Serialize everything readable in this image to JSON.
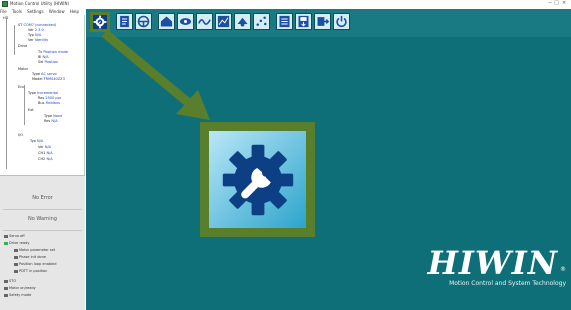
{
  "window": {
    "title": "Motion Control Utility (HIWIN)",
    "controls": [
      "−",
      "□",
      "×"
    ]
  },
  "menu": [
    "File",
    "Tools",
    "Settings",
    "Window",
    "Help"
  ],
  "tree": {
    "nodes": [
      {
        "label": "HD",
        "kind": "root"
      },
      {
        "label": "ST",
        "value": "COM7 (connected)"
      },
      {
        "label": "Ver",
        "value": "2.3.0"
      },
      {
        "label": "Typ",
        "value": "N/A"
      },
      {
        "label": "Ver",
        "value": "Identity"
      },
      {
        "label": "Drive",
        "kind": "group"
      },
      {
        "label": "Tx",
        "value": "Position mode"
      },
      {
        "label": "Bl",
        "value": "N/A"
      },
      {
        "label": "Sel",
        "value": "Position"
      },
      {
        "label": "Motor",
        "kind": "group"
      },
      {
        "label": "Type",
        "value": "AC servo"
      },
      {
        "label": "Model",
        "value": "FRMS40ZZ3"
      },
      {
        "label": "Enc",
        "kind": "group"
      },
      {
        "label": "Type",
        "value": "Incremental"
      },
      {
        "label": "Res",
        "value": "2500 ppr"
      },
      {
        "label": "Bus",
        "value": "Fieldbus"
      },
      {
        "label": "Ext",
        "kind": "group"
      },
      {
        "label": "Type",
        "value": "None"
      },
      {
        "label": "Res",
        "value": "N/A"
      },
      {
        "label": "I/O",
        "kind": "group"
      },
      {
        "label": "Typ",
        "value": "N/A"
      },
      {
        "label": "Ver",
        "value": "N/A"
      },
      {
        "label": "CH1",
        "value": "N/A"
      },
      {
        "label": "CH2",
        "value": "N/A"
      }
    ]
  },
  "status": {
    "error": "No Error",
    "warning": "No Warning",
    "items": [
      {
        "label": "Servo off",
        "color": "gray"
      },
      {
        "label": "Drive ready",
        "color": "green"
      },
      {
        "label": "Motor parameter set",
        "color": "gray"
      },
      {
        "label": "Phase init done",
        "color": "gray"
      },
      {
        "label": "Position loop enabled",
        "color": "gray"
      },
      {
        "label": "PDTT in position",
        "color": "gray"
      },
      {
        "label": "STO",
        "color": "gray"
      },
      {
        "label": "Motor on/ready",
        "color": "gray"
      },
      {
        "label": "Safety mode",
        "color": "gray"
      }
    ]
  },
  "toolbar": {
    "buttons": [
      {
        "icon": "gear-wrench-icon",
        "highlighted": true
      },
      {
        "icon": "document-icon"
      },
      {
        "icon": "steering-wheel-icon"
      },
      {
        "icon": "home-icon"
      },
      {
        "icon": "eye-icon"
      },
      {
        "icon": "wave-icon"
      },
      {
        "icon": "chart-icon"
      },
      {
        "icon": "motion-icon"
      },
      {
        "icon": "scatter-icon"
      },
      {
        "icon": "doc-list-icon"
      },
      {
        "icon": "save-icon"
      },
      {
        "icon": "upload-icon"
      },
      {
        "icon": "power-icon"
      }
    ]
  },
  "brand": {
    "logo": "HIWIN",
    "reg": "®",
    "tagline": "Motion Control and System Technology"
  },
  "colors": {
    "main_bg": "#0e6f79",
    "highlight": "#5a7f2c",
    "gear": "#0d3f85"
  }
}
